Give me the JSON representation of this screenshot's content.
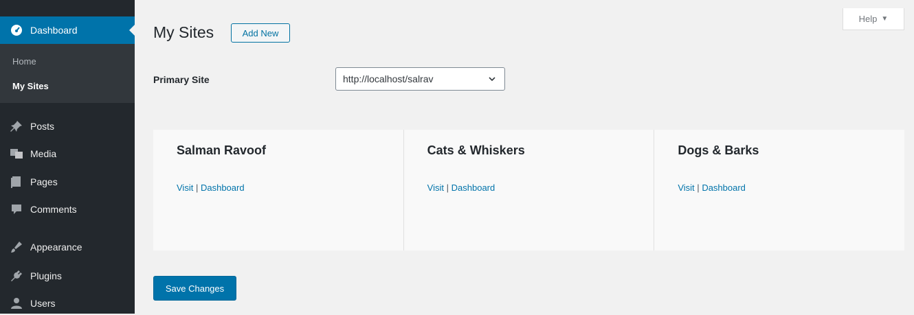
{
  "sidebar": {
    "current": {
      "label": "Dashboard",
      "icon": "dashboard-icon"
    },
    "submenu": [
      {
        "label": "Home",
        "current": false
      },
      {
        "label": "My Sites",
        "current": true
      }
    ],
    "items": [
      {
        "label": "Posts",
        "icon": "pin-icon"
      },
      {
        "label": "Media",
        "icon": "media-icon"
      },
      {
        "label": "Pages",
        "icon": "pages-icon"
      },
      {
        "label": "Comments",
        "icon": "comments-icon"
      },
      {
        "label": "Appearance",
        "icon": "appearance-icon"
      },
      {
        "label": "Plugins",
        "icon": "plugins-icon"
      },
      {
        "label": "Users",
        "icon": "users-icon"
      }
    ]
  },
  "header": {
    "title": "My Sites",
    "add_new_label": "Add New",
    "help_label": "Help"
  },
  "primary_site": {
    "label": "Primary Site",
    "value": "http://localhost/salrav"
  },
  "sites": [
    {
      "name": "Salman Ravoof",
      "visit_label": "Visit",
      "separator": "|",
      "dashboard_label": "Dashboard"
    },
    {
      "name": "Cats & Whiskers",
      "visit_label": "Visit",
      "separator": "|",
      "dashboard_label": "Dashboard"
    },
    {
      "name": "Dogs & Barks",
      "visit_label": "Visit",
      "separator": "|",
      "dashboard_label": "Dashboard"
    }
  ],
  "save_label": "Save Changes",
  "colors": {
    "accent": "#0073aa",
    "sidebar_bg": "#23282d",
    "submenu_bg": "#32373c",
    "page_bg": "#f1f1f1"
  }
}
